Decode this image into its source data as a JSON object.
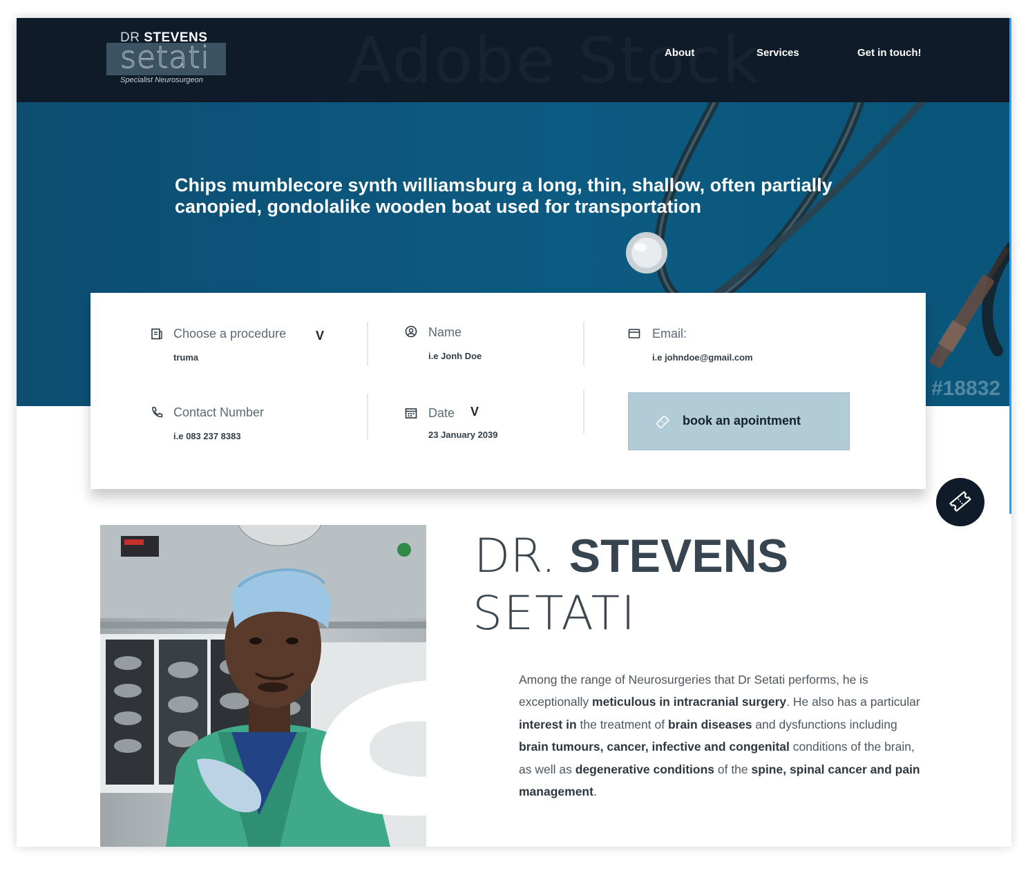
{
  "header": {
    "logo": {
      "dr": "DR",
      "stevens": "STEVENS",
      "setati": "setati",
      "tagline": "Specialist Neurosurgeon"
    },
    "watermark": "Adobe Stock",
    "nav": [
      {
        "label": "About"
      },
      {
        "label": "Services"
      },
      {
        "label": "Get in touch!"
      }
    ]
  },
  "hero": {
    "headline": "Chips mumblecore synth williamsburg a long, thin, shallow, often partially canopied, gondolalike wooden boat used for transportation",
    "image_code": "#18832"
  },
  "booking": {
    "procedure": {
      "label": "Choose a procedure",
      "value": "truma",
      "icon": "document-icon"
    },
    "name": {
      "label": "Name",
      "value": "i.e Jonh Doe",
      "icon": "user-circle-icon"
    },
    "email": {
      "label": "Email:",
      "value": "i.e johndoe@gmail.com",
      "icon": "envelope-icon"
    },
    "contact": {
      "label": "Contact Number",
      "value": "i.e 083 237 8383",
      "icon": "phone-icon"
    },
    "date": {
      "label": "Date",
      "value": "23 January 2039",
      "icon": "calendar-icon"
    },
    "caret": "V",
    "button": {
      "label": "book an apointment",
      "icon": "ticket-icon"
    }
  },
  "about": {
    "name_dr": "DR.",
    "name_stevens": "STEVENS",
    "name_setati": "SETATI",
    "photo_letter": "S",
    "bio": [
      {
        "t": "Among the range of Neurosurgeries that Dr Setati performs, he is exceptionally ",
        "b": false
      },
      {
        "t": "meticulous in intracranial surgery",
        "b": true
      },
      {
        "t": ". He also has a particular ",
        "b": false
      },
      {
        "t": "interest in",
        "b": true
      },
      {
        "t": " the treatment of ",
        "b": false
      },
      {
        "t": "brain diseases",
        "b": true
      },
      {
        "t": " and dysfunctions including ",
        "b": false
      },
      {
        "t": "brain tumours, cancer, infective and congenital",
        "b": true
      },
      {
        "t": " conditions of the brain, as well as ",
        "b": false
      },
      {
        "t": "degenerative conditions",
        "b": true
      },
      {
        "t": " of the ",
        "b": false
      },
      {
        "t": "spine, spinal cancer and pain management",
        "b": true
      },
      {
        "t": ".",
        "b": false
      }
    ]
  },
  "colors": {
    "header_bg": "#0f1b28",
    "hero_blue": "#0c5b82",
    "button_bg": "#b1ccd7",
    "heading": "#364550"
  }
}
